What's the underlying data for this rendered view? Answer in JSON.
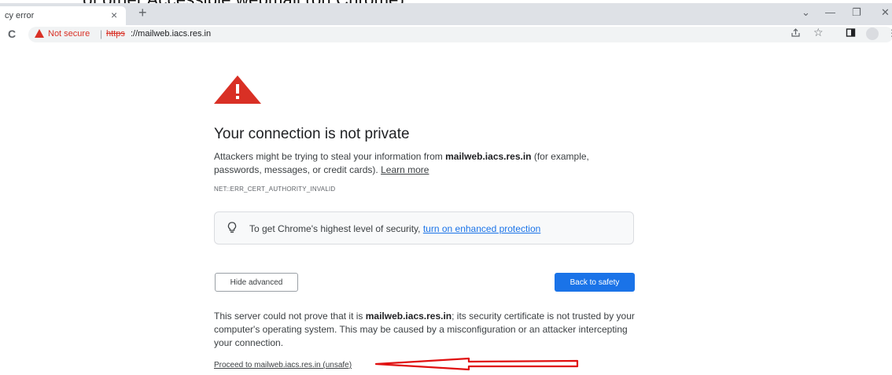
{
  "window": {
    "cropped_heading": "... of other Accessible webmail (on Chrome)",
    "tab_title": "cy error",
    "tab_close": "×",
    "new_tab": "+",
    "controls": {
      "dropdown": "⌄",
      "minimize": "—",
      "restore": "❐",
      "close": "✕"
    }
  },
  "address_bar": {
    "reload": "C",
    "security_label": "Not secure",
    "separator": "|",
    "url_scheme": "https",
    "url_rest": "://mailweb.iacs.res.in",
    "icons": [
      "share-icon",
      "star-icon",
      "side-panel-icon",
      "profile-icon",
      "menu-icon"
    ]
  },
  "interstitial": {
    "heading": "Your connection is not private",
    "intro_before": "Attackers might be trying to steal your information from ",
    "intro_domain": "mailweb.iacs.res.in",
    "intro_after": " (for example, passwords, messages, or credit cards).",
    "learn_more": "Learn more",
    "error_code": "NET::ERR_CERT_AUTHORITY_INVALID",
    "protection_text": "To get Chrome's highest level of security, ",
    "protection_link": "turn on enhanced protection",
    "hide_advanced": "Hide advanced",
    "back_to_safety": "Back to safety",
    "details_before": "This server could not prove that it is ",
    "details_domain": "mailweb.iacs.res.in",
    "details_after": "; its security certificate is not trusted by your computer's operating system. This may be caused by a misconfiguration or an attacker intercepting your connection.",
    "proceed_link": "Proceed to mailweb.iacs.res.in (unsafe)"
  },
  "colors": {
    "warning_red": "#d93025",
    "primary_blue": "#1a73e8",
    "annotation_arrow": "#e01010"
  }
}
